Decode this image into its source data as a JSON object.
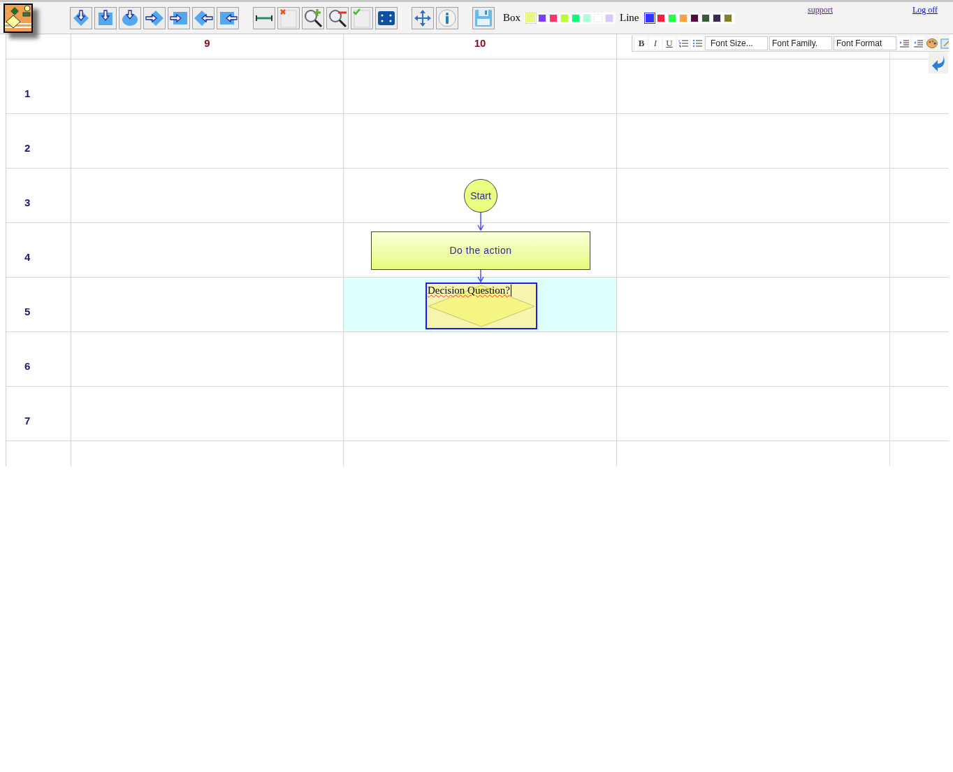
{
  "toolbar": {
    "box_label": "Box",
    "box_colors": [
      {
        "color": "#eaf77d",
        "selected": true
      },
      {
        "color": "#7a3cff",
        "selected": false
      },
      {
        "color": "#ff3366",
        "selected": false
      },
      {
        "color": "#b6ff33",
        "selected": false
      },
      {
        "color": "#00ff77",
        "selected": false
      },
      {
        "color": "#a8ffd8",
        "selected": false
      },
      {
        "color": "#ffffff",
        "selected": false
      },
      {
        "color": "#d8c8ff",
        "selected": false
      }
    ],
    "line_label": "Line",
    "line_colors": [
      {
        "color": "#3333ff",
        "selected": true
      },
      {
        "color": "#ff1a40",
        "selected": false
      },
      {
        "color": "#22ff44",
        "selected": false
      },
      {
        "color": "#ffa040",
        "selected": false
      },
      {
        "color": "#550a44",
        "selected": false
      },
      {
        "color": "#3a5a3a",
        "selected": false
      },
      {
        "color": "#3a2a50",
        "selected": false
      },
      {
        "color": "#7f8029",
        "selected": false
      }
    ]
  },
  "links": [
    {
      "label": "support",
      "visited": true
    },
    {
      "label": "Log off",
      "visited": false
    }
  ],
  "editor_toolbar": {
    "bold": "B",
    "italic": "I",
    "underline": "U",
    "font_size": "Font Size...",
    "font_family": "Font Family.",
    "font_format": "Font Format"
  },
  "grid": {
    "columns": [
      {
        "label": "9",
        "selected": false
      },
      {
        "label": "10",
        "selected": true
      }
    ],
    "rows": [
      {
        "label": "1",
        "selected": false
      },
      {
        "label": "2",
        "selected": false
      },
      {
        "label": "3",
        "selected": false
      },
      {
        "label": "4",
        "selected": false
      },
      {
        "label": "5",
        "selected": true
      },
      {
        "label": "6",
        "selected": false
      },
      {
        "label": "7",
        "selected": false
      }
    ]
  },
  "diagram": {
    "nodes": [
      {
        "kind": "terminal",
        "text": "Start"
      },
      {
        "kind": "process",
        "text": "Do the action"
      },
      {
        "kind": "decision",
        "text": "Decision Question?",
        "editing": true
      }
    ]
  }
}
